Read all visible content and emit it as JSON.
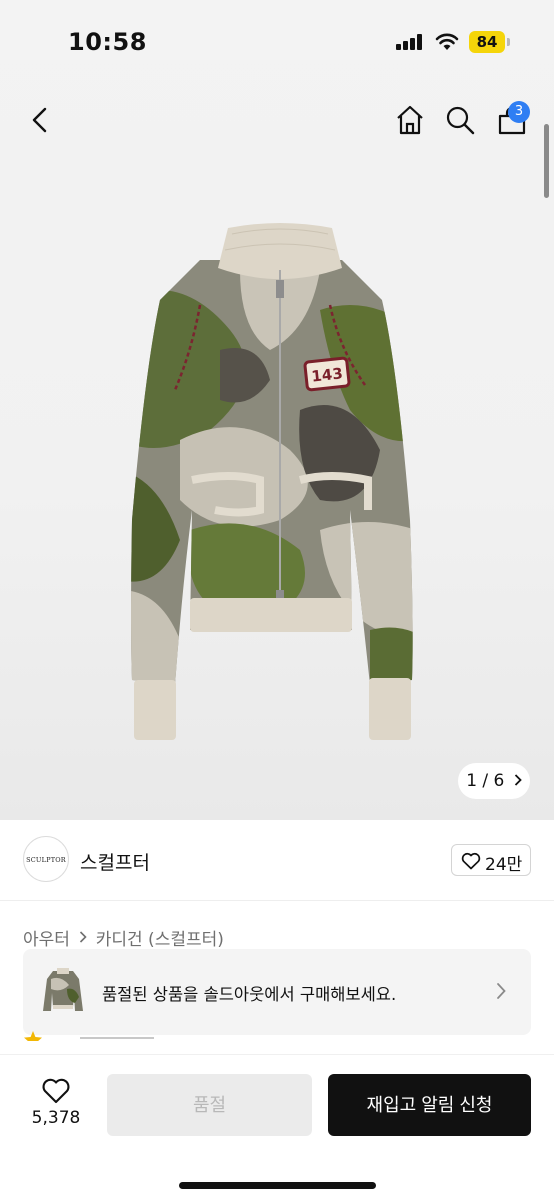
{
  "status_bar": {
    "time": "10:58",
    "battery": "84",
    "battery_color": "#f5d50a"
  },
  "nav": {
    "back_icon": "chevron-left-icon",
    "home_icon": "home-icon",
    "search_icon": "search-icon",
    "cart_icon": "shopping-bag-icon",
    "cart_badge": "3",
    "badge_color": "#2f7ef3"
  },
  "gallery": {
    "pager": "1 / 6"
  },
  "product_image": {
    "patch_number": "143"
  },
  "brand": {
    "logo_text": "SCULPTOR",
    "name": "스컬프터",
    "likes": "24만"
  },
  "breadcrumb": {
    "items": [
      "아우터",
      "카디건 (스컬프터)"
    ]
  },
  "soldout_banner": {
    "text": "품절된 상품을 솔드아웃에서 구매해보세요."
  },
  "bottom_bar": {
    "wish_count": "5,378",
    "soldout_label": "품절",
    "restock_label": "재입고 알림 신청",
    "primary_color": "#111111"
  }
}
